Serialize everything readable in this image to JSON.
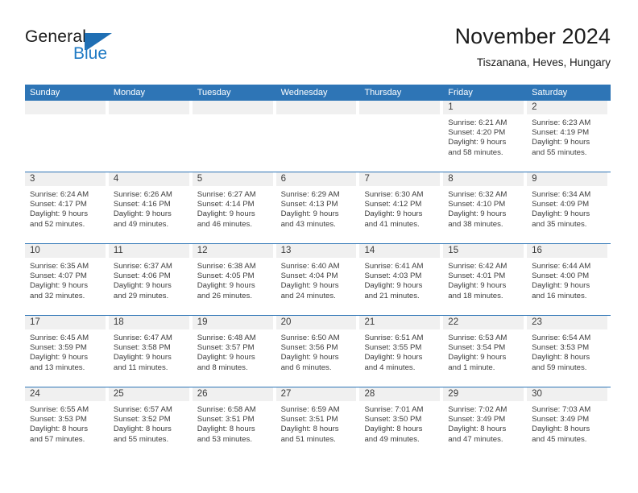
{
  "brand": {
    "name_part1": "General",
    "name_part2": "Blue",
    "flag_color": "#1f6fb4",
    "blue_color": "#1f7ac4"
  },
  "header": {
    "title": "November 2024",
    "subtitle": "Tiszanana, Heves, Hungary"
  },
  "theme": {
    "header_blue": "#2e75b6",
    "daynum_band": "#f0f0f0",
    "text": "#3d3d3d"
  },
  "calendar": {
    "weekday_headers": [
      "Sunday",
      "Monday",
      "Tuesday",
      "Wednesday",
      "Thursday",
      "Friday",
      "Saturday"
    ],
    "weeks": [
      [
        {
          "day": "",
          "empty": true
        },
        {
          "day": "",
          "empty": true
        },
        {
          "day": "",
          "empty": true
        },
        {
          "day": "",
          "empty": true
        },
        {
          "day": "",
          "empty": true
        },
        {
          "day": "1",
          "sunrise": "Sunrise: 6:21 AM",
          "sunset": "Sunset: 4:20 PM",
          "daylight1": "Daylight: 9 hours",
          "daylight2": "and 58 minutes."
        },
        {
          "day": "2",
          "sunrise": "Sunrise: 6:23 AM",
          "sunset": "Sunset: 4:19 PM",
          "daylight1": "Daylight: 9 hours",
          "daylight2": "and 55 minutes."
        }
      ],
      [
        {
          "day": "3",
          "sunrise": "Sunrise: 6:24 AM",
          "sunset": "Sunset: 4:17 PM",
          "daylight1": "Daylight: 9 hours",
          "daylight2": "and 52 minutes."
        },
        {
          "day": "4",
          "sunrise": "Sunrise: 6:26 AM",
          "sunset": "Sunset: 4:16 PM",
          "daylight1": "Daylight: 9 hours",
          "daylight2": "and 49 minutes."
        },
        {
          "day": "5",
          "sunrise": "Sunrise: 6:27 AM",
          "sunset": "Sunset: 4:14 PM",
          "daylight1": "Daylight: 9 hours",
          "daylight2": "and 46 minutes."
        },
        {
          "day": "6",
          "sunrise": "Sunrise: 6:29 AM",
          "sunset": "Sunset: 4:13 PM",
          "daylight1": "Daylight: 9 hours",
          "daylight2": "and 43 minutes."
        },
        {
          "day": "7",
          "sunrise": "Sunrise: 6:30 AM",
          "sunset": "Sunset: 4:12 PM",
          "daylight1": "Daylight: 9 hours",
          "daylight2": "and 41 minutes."
        },
        {
          "day": "8",
          "sunrise": "Sunrise: 6:32 AM",
          "sunset": "Sunset: 4:10 PM",
          "daylight1": "Daylight: 9 hours",
          "daylight2": "and 38 minutes."
        },
        {
          "day": "9",
          "sunrise": "Sunrise: 6:34 AM",
          "sunset": "Sunset: 4:09 PM",
          "daylight1": "Daylight: 9 hours",
          "daylight2": "and 35 minutes."
        }
      ],
      [
        {
          "day": "10",
          "sunrise": "Sunrise: 6:35 AM",
          "sunset": "Sunset: 4:07 PM",
          "daylight1": "Daylight: 9 hours",
          "daylight2": "and 32 minutes."
        },
        {
          "day": "11",
          "sunrise": "Sunrise: 6:37 AM",
          "sunset": "Sunset: 4:06 PM",
          "daylight1": "Daylight: 9 hours",
          "daylight2": "and 29 minutes."
        },
        {
          "day": "12",
          "sunrise": "Sunrise: 6:38 AM",
          "sunset": "Sunset: 4:05 PM",
          "daylight1": "Daylight: 9 hours",
          "daylight2": "and 26 minutes."
        },
        {
          "day": "13",
          "sunrise": "Sunrise: 6:40 AM",
          "sunset": "Sunset: 4:04 PM",
          "daylight1": "Daylight: 9 hours",
          "daylight2": "and 24 minutes."
        },
        {
          "day": "14",
          "sunrise": "Sunrise: 6:41 AM",
          "sunset": "Sunset: 4:03 PM",
          "daylight1": "Daylight: 9 hours",
          "daylight2": "and 21 minutes."
        },
        {
          "day": "15",
          "sunrise": "Sunrise: 6:42 AM",
          "sunset": "Sunset: 4:01 PM",
          "daylight1": "Daylight: 9 hours",
          "daylight2": "and 18 minutes."
        },
        {
          "day": "16",
          "sunrise": "Sunrise: 6:44 AM",
          "sunset": "Sunset: 4:00 PM",
          "daylight1": "Daylight: 9 hours",
          "daylight2": "and 16 minutes."
        }
      ],
      [
        {
          "day": "17",
          "sunrise": "Sunrise: 6:45 AM",
          "sunset": "Sunset: 3:59 PM",
          "daylight1": "Daylight: 9 hours",
          "daylight2": "and 13 minutes."
        },
        {
          "day": "18",
          "sunrise": "Sunrise: 6:47 AM",
          "sunset": "Sunset: 3:58 PM",
          "daylight1": "Daylight: 9 hours",
          "daylight2": "and 11 minutes."
        },
        {
          "day": "19",
          "sunrise": "Sunrise: 6:48 AM",
          "sunset": "Sunset: 3:57 PM",
          "daylight1": "Daylight: 9 hours",
          "daylight2": "and 8 minutes."
        },
        {
          "day": "20",
          "sunrise": "Sunrise: 6:50 AM",
          "sunset": "Sunset: 3:56 PM",
          "daylight1": "Daylight: 9 hours",
          "daylight2": "and 6 minutes."
        },
        {
          "day": "21",
          "sunrise": "Sunrise: 6:51 AM",
          "sunset": "Sunset: 3:55 PM",
          "daylight1": "Daylight: 9 hours",
          "daylight2": "and 4 minutes."
        },
        {
          "day": "22",
          "sunrise": "Sunrise: 6:53 AM",
          "sunset": "Sunset: 3:54 PM",
          "daylight1": "Daylight: 9 hours",
          "daylight2": "and 1 minute."
        },
        {
          "day": "23",
          "sunrise": "Sunrise: 6:54 AM",
          "sunset": "Sunset: 3:53 PM",
          "daylight1": "Daylight: 8 hours",
          "daylight2": "and 59 minutes."
        }
      ],
      [
        {
          "day": "24",
          "sunrise": "Sunrise: 6:55 AM",
          "sunset": "Sunset: 3:53 PM",
          "daylight1": "Daylight: 8 hours",
          "daylight2": "and 57 minutes."
        },
        {
          "day": "25",
          "sunrise": "Sunrise: 6:57 AM",
          "sunset": "Sunset: 3:52 PM",
          "daylight1": "Daylight: 8 hours",
          "daylight2": "and 55 minutes."
        },
        {
          "day": "26",
          "sunrise": "Sunrise: 6:58 AM",
          "sunset": "Sunset: 3:51 PM",
          "daylight1": "Daylight: 8 hours",
          "daylight2": "and 53 minutes."
        },
        {
          "day": "27",
          "sunrise": "Sunrise: 6:59 AM",
          "sunset": "Sunset: 3:51 PM",
          "daylight1": "Daylight: 8 hours",
          "daylight2": "and 51 minutes."
        },
        {
          "day": "28",
          "sunrise": "Sunrise: 7:01 AM",
          "sunset": "Sunset: 3:50 PM",
          "daylight1": "Daylight: 8 hours",
          "daylight2": "and 49 minutes."
        },
        {
          "day": "29",
          "sunrise": "Sunrise: 7:02 AM",
          "sunset": "Sunset: 3:49 PM",
          "daylight1": "Daylight: 8 hours",
          "daylight2": "and 47 minutes."
        },
        {
          "day": "30",
          "sunrise": "Sunrise: 7:03 AM",
          "sunset": "Sunset: 3:49 PM",
          "daylight1": "Daylight: 8 hours",
          "daylight2": "and 45 minutes."
        }
      ]
    ]
  }
}
